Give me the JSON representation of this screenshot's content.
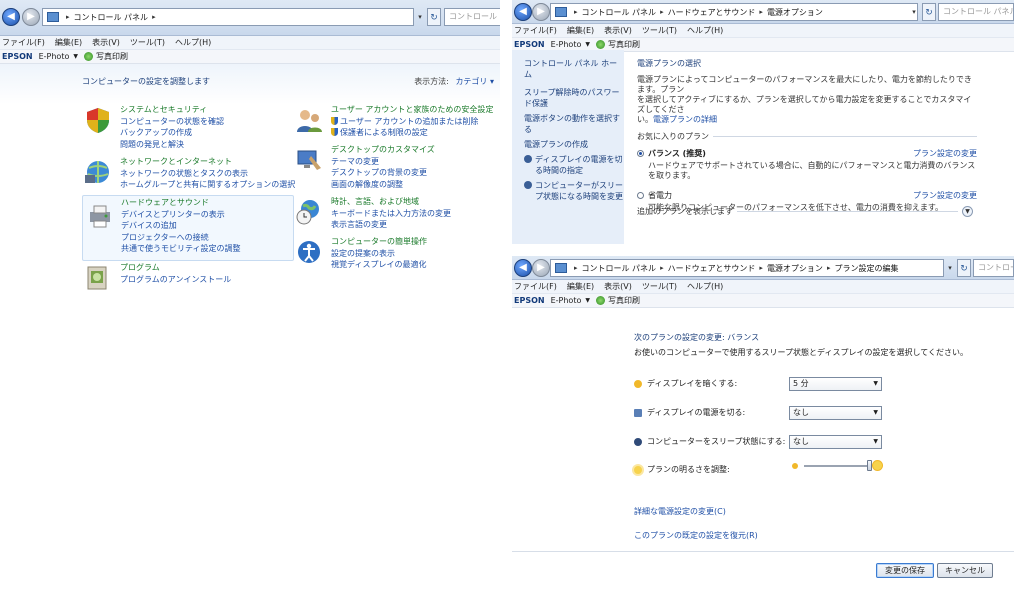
{
  "left": {
    "address": {
      "crumbs": [
        "コントロール パネル"
      ],
      "search_placeholder": "コントロール パ"
    },
    "menu": [
      "ファイル(F)",
      "編集(E)",
      "表示(V)",
      "ツール(T)",
      "ヘルプ(H)"
    ],
    "epson": {
      "brand": "EPSON",
      "ephoto": "E-Photo",
      "print": "写真印刷"
    },
    "page_title": "コンピューターの設定を調整します",
    "view_by_label": "表示方法:",
    "view_by_value": "カテゴリ ▾",
    "categories": [
      {
        "title": "システムとセキュリティ",
        "links": [
          "コンピューターの状態を確認",
          "バックアップの作成",
          "問題の発見と解決"
        ]
      },
      {
        "title": "ネットワークとインターネット",
        "links": [
          "ネットワークの状態とタスクの表示",
          "ホームグループと共有に関するオプションの選択"
        ]
      },
      {
        "title": "ハードウェアとサウンド",
        "links": [
          "デバイスとプリンターの表示",
          "デバイスの追加",
          "プロジェクターへの接続",
          "共通で使うモビリティ設定の調整"
        ]
      },
      {
        "title": "プログラム",
        "links": [
          "プログラムのアンインストール"
        ]
      },
      {
        "title": "ユーザー アカウントと家族のための安全設定",
        "links": [
          "ユーザー アカウントの追加または削除",
          "保護者による制限の設定"
        ]
      },
      {
        "title": "デスクトップのカスタマイズ",
        "links": [
          "テーマの変更",
          "デスクトップの背景の変更",
          "画面の解像度の調整"
        ]
      },
      {
        "title": "時計、言語、および地域",
        "links": [
          "キーボードまたは入力方法の変更",
          "表示言語の変更"
        ]
      },
      {
        "title": "コンピューターの簡単操作",
        "links": [
          "設定の提案の表示",
          "視覚ディスプレイの最適化"
        ]
      }
    ]
  },
  "topright": {
    "address": {
      "crumbs": [
        "コントロール パネル",
        "ハードウェアとサウンド",
        "電源オプション"
      ],
      "search_placeholder": "コントロール パネルの"
    },
    "menu": [
      "ファイル(F)",
      "編集(E)",
      "表示(V)",
      "ツール(T)",
      "ヘルプ(H)"
    ],
    "epson": {
      "brand": "EPSON",
      "ephoto": "E-Photo",
      "print": "写真印刷"
    },
    "sidebar": {
      "home": "コントロール パネル ホーム",
      "items": [
        "スリープ解除時のパスワード保護",
        "電源ボタンの動作を選択する",
        "電源プランの作成"
      ],
      "icon_items": [
        "ディスプレイの電源を切る時間の指定",
        "コンピューターがスリープ状態になる時間を変更"
      ]
    },
    "title": "電源プランの選択",
    "desc1": "電源プランによってコンピューターのパフォーマンスを最大にしたり、電力を節約したりできます。プラン",
    "desc2": "を選択してアクティブにするか、プランを選択してから電力設定を変更することでカスタマイズしてくださ",
    "desc3_prefix": "い。",
    "desc3_link": "電源プランの詳細",
    "favorites": "お気に入りのプラン",
    "plans": [
      {
        "name": "バランス (推奨)",
        "change": "プラン設定の変更",
        "desc": "ハードウェアでサポートされている場合に、自動的にパフォーマンスと電力消費のバランスを取ります。",
        "selected": true
      },
      {
        "name": "省電力",
        "change": "プラン設定の変更",
        "desc": "可能な限りコンピューターのパフォーマンスを低下させ、電力の消費を抑えます。",
        "selected": false
      }
    ],
    "extra": "追加のプランを表示します"
  },
  "bottomright": {
    "address": {
      "crumbs": [
        "コントロール パネル",
        "ハードウェアとサウンド",
        "電源オプション",
        "プラン設定の編集"
      ],
      "search_placeholder": "コントロー"
    },
    "menu": [
      "ファイル(F)",
      "編集(E)",
      "表示(V)",
      "ツール(T)",
      "ヘルプ(H)"
    ],
    "epson": {
      "brand": "EPSON",
      "ephoto": "E-Photo",
      "print": "写真印刷"
    },
    "heading": "次のプランの設定の変更: バランス",
    "subheading": "お使いのコンピューターで使用するスリープ状態とディスプレイの設定を選択してください。",
    "settings": [
      {
        "label": "ディスプレイを暗くする:",
        "value": "5 分"
      },
      {
        "label": "ディスプレイの電源を切る:",
        "value": "なし"
      },
      {
        "label": "コンピューターをスリープ状態にする:",
        "value": "なし"
      }
    ],
    "brightness_label": "プランの明るさを調整:",
    "brightness_level": 1.0,
    "links": [
      "詳細な電源設定の変更(C)",
      "このプランの既定の設定を復元(R)"
    ],
    "save": "変更の保存",
    "cancel": "キャンセル"
  }
}
